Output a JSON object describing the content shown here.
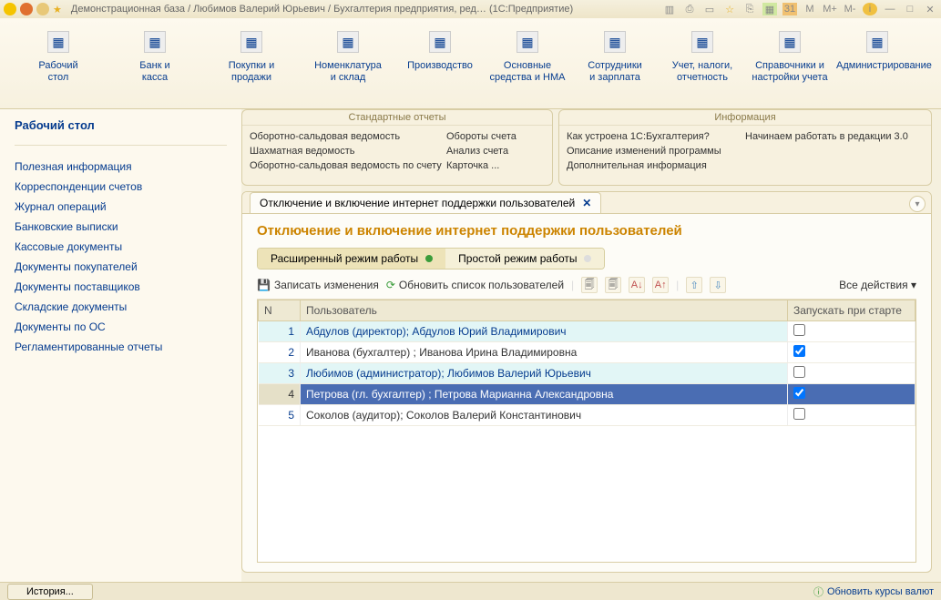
{
  "titlebar": {
    "title": "Демонстрационная база / Любимов Валерий Юрьевич / Бухгалтерия предприятия, ред… (1С:Предприятие)",
    "m": "M",
    "mplus": "M+",
    "mminus": "M-"
  },
  "toolbar": [
    {
      "label": "Рабочий\nстол"
    },
    {
      "label": "Банк и\nкасса"
    },
    {
      "label": "Покупки и\nпродажи"
    },
    {
      "label": "Номенклатура\nи склад"
    },
    {
      "label": "Производство"
    },
    {
      "label": "Основные\nсредства и НМА"
    },
    {
      "label": "Сотрудники\nи зарплата"
    },
    {
      "label": "Учет, налоги,\nотчетность"
    },
    {
      "label": "Справочники и\nнастройки учета"
    },
    {
      "label": "Администрирование"
    }
  ],
  "sidebar": {
    "title": "Рабочий стол",
    "links": [
      "Полезная информация",
      "Корреспонденции счетов",
      "Журнал операций",
      "Банковские выписки",
      "Кассовые документы",
      "Документы покупателей",
      "Документы поставщиков",
      "Складские документы",
      "Документы по ОС",
      "Регламентированные отчеты"
    ]
  },
  "boxes": {
    "reports": {
      "title": "Стандартные отчеты",
      "col1": [
        "Оборотно-сальдовая ведомость",
        "Шахматная ведомость",
        "Оборотно-сальдовая ведомость по счету"
      ],
      "col2": [
        "Обороты счета",
        "Анализ счета",
        "Карточка ..."
      ]
    },
    "info": {
      "title": "Информация",
      "col1": [
        "Как устроена 1С:Бухгалтерия?",
        "Описание изменений программы",
        "Дополнительная информация"
      ],
      "col2": [
        "Начинаем работать в редакции 3.0"
      ]
    }
  },
  "tab": {
    "label": "Отключение и включение интернет поддержки пользователей"
  },
  "page": {
    "heading": "Отключение и включение интернет поддержки пользователей",
    "mode_ext": "Расширенный режим работы",
    "mode_simple": "Простой режим работы",
    "act_save": "Записать изменения",
    "act_refresh": "Обновить список пользователей",
    "all_actions": "Все действия"
  },
  "table": {
    "col_n": "N",
    "col_user": "Пользователь",
    "col_start": "Запускать при старте",
    "rows": [
      {
        "n": "1",
        "user": "Абдулов (директор); Абдулов Юрий Владимирович",
        "chk": false,
        "alt": true
      },
      {
        "n": "2",
        "user": "Иванова (бухгалтер) ; Иванова Ирина Владимировна",
        "chk": true,
        "alt": false
      },
      {
        "n": "3",
        "user": "Любимов (администратор); Любимов Валерий Юрьевич",
        "chk": false,
        "alt": true
      },
      {
        "n": "4",
        "user": "Петрова (гл. бухгалтер) ; Петрова Марианна Александровна",
        "chk": true,
        "sel": true
      },
      {
        "n": "5",
        "user": "Соколов (аудитор); Соколов Валерий Константинович",
        "chk": false,
        "alt": false
      }
    ]
  },
  "status": {
    "history": "История...",
    "rates": "Обновить курсы валют"
  }
}
